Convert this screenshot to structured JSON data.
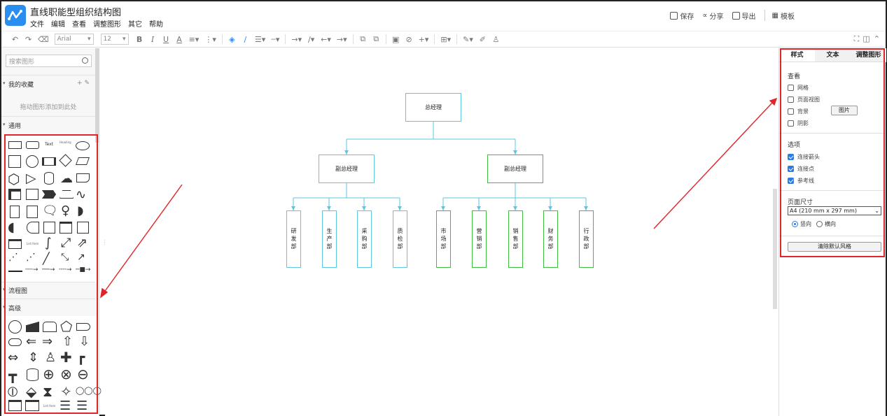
{
  "app": {
    "title": "直线职能型组织结构图",
    "menu": [
      "文件",
      "编辑",
      "查看",
      "调整图形",
      "其它",
      "帮助"
    ],
    "header_actions": [
      {
        "label": "保存",
        "icon": "save-icon"
      },
      {
        "label": "分享",
        "icon": "share-icon"
      },
      {
        "label": "导出",
        "icon": "export-icon"
      },
      {
        "label": "模板",
        "icon": "template-icon"
      }
    ]
  },
  "toolbar": {
    "font": "Arial",
    "font_size": "12",
    "bold": "B",
    "italic": "I",
    "underline": "U",
    "font_color": "A"
  },
  "left_panel": {
    "search_placeholder": "搜索图形",
    "favorites_title": "我的收藏",
    "favorites_hint": "拖动图形添加到此处",
    "general_title": "通用",
    "flowchart_title": "流程图",
    "advanced_title": "高级",
    "text_shape": "Text",
    "heading_shape": "Heading",
    "list_item_shape": "List Item"
  },
  "canvas": {
    "root": "总经理",
    "vp_left": "副总经理",
    "vp_right": "副总经理",
    "left_depts": [
      "研发部",
      "生产部",
      "采购部",
      "质检部"
    ],
    "right_depts": [
      "市场部",
      "营销部",
      "销售部",
      "财务部",
      "行政部"
    ],
    "colors": {
      "blue": "#5bc7e0",
      "green": "#3fbf3f",
      "annotation": "#e0242a"
    }
  },
  "right_panel": {
    "tabs": [
      "样式",
      "文本",
      "调整图形"
    ],
    "view_title": "查看",
    "view_options": [
      {
        "label": "网格",
        "checked": false
      },
      {
        "label": "页面视图",
        "checked": false
      },
      {
        "label": "背景",
        "checked": false
      },
      {
        "label": "阴影",
        "checked": false
      }
    ],
    "image_button": "图片",
    "options_title": "选项",
    "options": [
      {
        "label": "连接箭头",
        "checked": true
      },
      {
        "label": "连接点",
        "checked": true
      },
      {
        "label": "参考线",
        "checked": true
      }
    ],
    "page_size_title": "页面尺寸",
    "page_size_value": "A4 (210 mm x 297 mm)",
    "orientation": [
      {
        "label": "竖向",
        "selected": true
      },
      {
        "label": "横向",
        "selected": false
      }
    ],
    "reset_button": "清除默认风格"
  }
}
